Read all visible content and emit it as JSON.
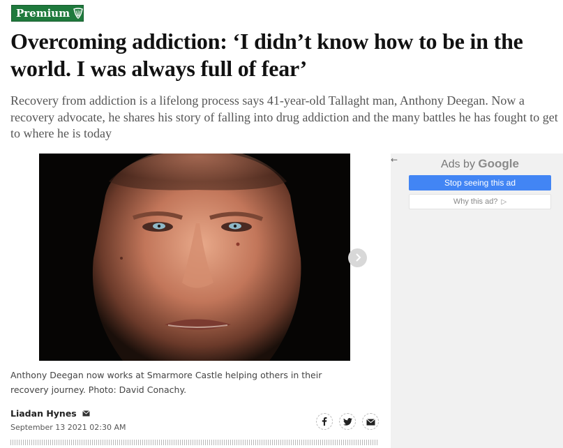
{
  "badge": {
    "label": "Premium",
    "icon": "harp-icon",
    "color": "#1f7a3d"
  },
  "article": {
    "headline": "Overcoming addiction: ‘I didn’t know how to be in the world. I was always full of fear’",
    "standfirst": "Recovery from addiction is a lifelong process says 41-year-old Tallaght man, Anthony Deegan. Now a recovery advocate, he shares his story of falling into drug addiction and the many battles he has fought to get to where he is today",
    "caption": "Anthony Deegan now works at Smarmore Castle helping others in their recovery journey. Photo: David Conachy.",
    "author": "Liadan Hynes",
    "date": "September 13 2021 02:30 AM"
  },
  "gallery": {
    "next_icon": "chevron-right-icon"
  },
  "share": {
    "icons": [
      "facebook-icon",
      "twitter-icon",
      "email-icon"
    ]
  },
  "ad": {
    "back_glyph": "←",
    "ads_by": "Ads by",
    "google": "Google",
    "stop_label": "Stop seeing this ad",
    "why_label": "Why this ad?",
    "accent": "#4285f4"
  }
}
